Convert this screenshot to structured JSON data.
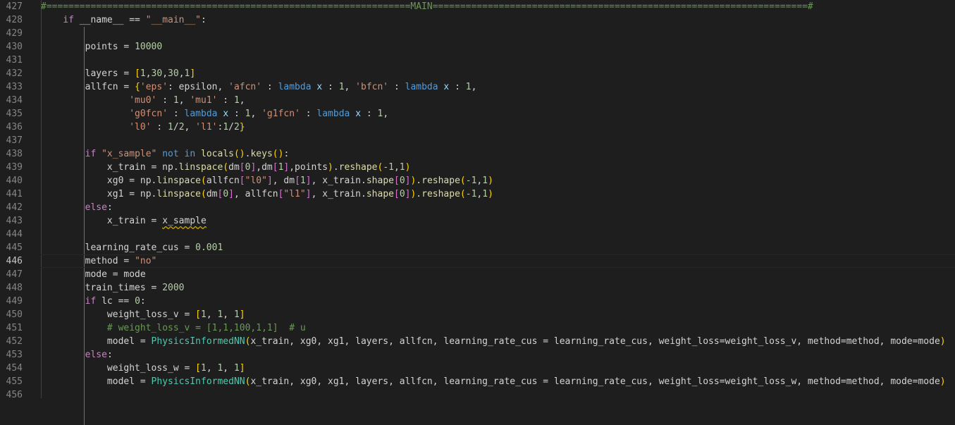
{
  "colors": {
    "background": "#1e1e1e",
    "line_number": "#858585",
    "line_number_active": "#c6c6c6",
    "default": "#d4d4d4",
    "keyword_control": "#c586c0",
    "keyword": "#569cd6",
    "string": "#ce9178",
    "number": "#b5cea8",
    "function": "#dcdcaa",
    "class": "#4ec9b0",
    "variable": "#9cdcfe",
    "comment": "#6a9955",
    "bracket1": "#ffd700",
    "bracket2": "#da70d6",
    "bracket3": "#179fff"
  },
  "editor": {
    "current_line": "446",
    "lines": [
      {
        "n": "427",
        "tokens": [
          [
            "#==================================================================MAIN====================================================================#",
            "comment"
          ]
        ]
      },
      {
        "n": "428",
        "tokens": [
          [
            "    ",
            ""
          ],
          [
            "if",
            "keyword_control"
          ],
          [
            " __name__ == ",
            ""
          ],
          [
            "\"__main__\"",
            "string"
          ],
          [
            ":",
            ""
          ]
        ]
      },
      {
        "n": "429",
        "tokens": []
      },
      {
        "n": "430",
        "tokens": [
          [
            "        points = ",
            ""
          ],
          [
            "10000",
            "number"
          ]
        ]
      },
      {
        "n": "431",
        "tokens": []
      },
      {
        "n": "432",
        "tokens": [
          [
            "        layers = ",
            ""
          ],
          [
            "[",
            "bracket1"
          ],
          [
            "1",
            "number"
          ],
          [
            ",",
            ""
          ],
          [
            "30",
            "number"
          ],
          [
            ",",
            ""
          ],
          [
            "30",
            "number"
          ],
          [
            ",",
            ""
          ],
          [
            "1",
            "number"
          ],
          [
            "]",
            "bracket1"
          ]
        ]
      },
      {
        "n": "433",
        "tokens": [
          [
            "        allfcn = ",
            ""
          ],
          [
            "{",
            "bracket1"
          ],
          [
            "'eps'",
            "string"
          ],
          [
            ": epsilon, ",
            ""
          ],
          [
            "'afcn'",
            "string"
          ],
          [
            " : ",
            ""
          ],
          [
            "lambda",
            "keyword"
          ],
          [
            " ",
            ""
          ],
          [
            "x",
            "variable"
          ],
          [
            " : ",
            ""
          ],
          [
            "1",
            "number"
          ],
          [
            ", ",
            ""
          ],
          [
            "'bfcn'",
            "string"
          ],
          [
            " : ",
            ""
          ],
          [
            "lambda",
            "keyword"
          ],
          [
            " ",
            ""
          ],
          [
            "x",
            "variable"
          ],
          [
            " : ",
            ""
          ],
          [
            "1",
            "number"
          ],
          [
            ",",
            ""
          ]
        ]
      },
      {
        "n": "434",
        "tokens": [
          [
            "                ",
            ""
          ],
          [
            "'mu0'",
            "string"
          ],
          [
            " : ",
            ""
          ],
          [
            "1",
            "number"
          ],
          [
            ", ",
            ""
          ],
          [
            "'mu1'",
            "string"
          ],
          [
            " : ",
            ""
          ],
          [
            "1",
            "number"
          ],
          [
            ",",
            ""
          ]
        ]
      },
      {
        "n": "435",
        "tokens": [
          [
            "                ",
            ""
          ],
          [
            "'g0fcn'",
            "string"
          ],
          [
            " : ",
            ""
          ],
          [
            "lambda",
            "keyword"
          ],
          [
            " ",
            ""
          ],
          [
            "x",
            "variable"
          ],
          [
            " : ",
            ""
          ],
          [
            "1",
            "number"
          ],
          [
            ", ",
            ""
          ],
          [
            "'g1fcn'",
            "string"
          ],
          [
            " : ",
            ""
          ],
          [
            "lambda",
            "keyword"
          ],
          [
            " ",
            ""
          ],
          [
            "x",
            "variable"
          ],
          [
            " : ",
            ""
          ],
          [
            "1",
            "number"
          ],
          [
            ",",
            ""
          ]
        ]
      },
      {
        "n": "436",
        "tokens": [
          [
            "                ",
            ""
          ],
          [
            "'l0'",
            "string"
          ],
          [
            " : ",
            ""
          ],
          [
            "1",
            "number"
          ],
          [
            "/",
            ""
          ],
          [
            "2",
            "number"
          ],
          [
            ", ",
            ""
          ],
          [
            "'l1'",
            "string"
          ],
          [
            ":",
            ""
          ],
          [
            "1",
            "number"
          ],
          [
            "/",
            ""
          ],
          [
            "2",
            "number"
          ],
          [
            "}",
            "bracket1"
          ]
        ]
      },
      {
        "n": "437",
        "tokens": []
      },
      {
        "n": "438",
        "tokens": [
          [
            "        ",
            ""
          ],
          [
            "if",
            "keyword_control"
          ],
          [
            " ",
            ""
          ],
          [
            "\"x_sample\"",
            "string"
          ],
          [
            " ",
            ""
          ],
          [
            "not",
            "keyword"
          ],
          [
            " ",
            ""
          ],
          [
            "in",
            "keyword"
          ],
          [
            " ",
            ""
          ],
          [
            "locals",
            "function"
          ],
          [
            "()",
            "bracket1"
          ],
          [
            ".",
            ""
          ],
          [
            "keys",
            "function"
          ],
          [
            "()",
            "bracket1"
          ],
          [
            ":",
            ""
          ]
        ]
      },
      {
        "n": "439",
        "tokens": [
          [
            "            x_train = np.",
            ""
          ],
          [
            "linspace",
            "function"
          ],
          [
            "(",
            "bracket1"
          ],
          [
            "dm",
            ""
          ],
          [
            "[",
            "bracket2"
          ],
          [
            "0",
            "number"
          ],
          [
            "]",
            "bracket2"
          ],
          [
            ",dm",
            ""
          ],
          [
            "[",
            "bracket2"
          ],
          [
            "1",
            "number"
          ],
          [
            "]",
            "bracket2"
          ],
          [
            ",points",
            ""
          ],
          [
            ")",
            "bracket1"
          ],
          [
            ".",
            ""
          ],
          [
            "reshape",
            "function"
          ],
          [
            "(",
            "bracket1"
          ],
          [
            "-1",
            "number"
          ],
          [
            ",",
            ""
          ],
          [
            "1",
            "number"
          ],
          [
            ")",
            "bracket1"
          ]
        ]
      },
      {
        "n": "440",
        "tokens": [
          [
            "            xg0 = np.",
            ""
          ],
          [
            "linspace",
            "function"
          ],
          [
            "(",
            "bracket1"
          ],
          [
            "allfcn",
            ""
          ],
          [
            "[",
            "bracket2"
          ],
          [
            "\"l0\"",
            "string"
          ],
          [
            "]",
            "bracket2"
          ],
          [
            ", dm",
            ""
          ],
          [
            "[",
            "bracket2"
          ],
          [
            "1",
            "number"
          ],
          [
            "]",
            "bracket2"
          ],
          [
            ", x_train.",
            ""
          ],
          [
            "shape",
            "function"
          ],
          [
            "[",
            "bracket2"
          ],
          [
            "0",
            "number"
          ],
          [
            "]",
            "bracket2"
          ],
          [
            ")",
            "bracket1"
          ],
          [
            ".",
            ""
          ],
          [
            "reshape",
            "function"
          ],
          [
            "(",
            "bracket1"
          ],
          [
            "-1",
            "number"
          ],
          [
            ",",
            ""
          ],
          [
            "1",
            "number"
          ],
          [
            ")",
            "bracket1"
          ]
        ]
      },
      {
        "n": "441",
        "tokens": [
          [
            "            xg1 = np.",
            ""
          ],
          [
            "linspace",
            "function"
          ],
          [
            "(",
            "bracket1"
          ],
          [
            "dm",
            ""
          ],
          [
            "[",
            "bracket2"
          ],
          [
            "0",
            "number"
          ],
          [
            "]",
            "bracket2"
          ],
          [
            ", allfcn",
            ""
          ],
          [
            "[",
            "bracket2"
          ],
          [
            "\"l1\"",
            "string"
          ],
          [
            "]",
            "bracket2"
          ],
          [
            ", x_train.",
            ""
          ],
          [
            "shape",
            "function"
          ],
          [
            "[",
            "bracket2"
          ],
          [
            "0",
            "number"
          ],
          [
            "]",
            "bracket2"
          ],
          [
            ")",
            "bracket1"
          ],
          [
            ".",
            ""
          ],
          [
            "reshape",
            "function"
          ],
          [
            "(",
            "bracket1"
          ],
          [
            "-1",
            "number"
          ],
          [
            ",",
            ""
          ],
          [
            "1",
            "number"
          ],
          [
            ")",
            "bracket1"
          ]
        ]
      },
      {
        "n": "442",
        "tokens": [
          [
            "        ",
            ""
          ],
          [
            "else",
            "keyword_control"
          ],
          [
            ":",
            ""
          ]
        ]
      },
      {
        "n": "443",
        "tokens": [
          [
            "            x_train = ",
            ""
          ],
          [
            "x_sample",
            "squiggle"
          ]
        ]
      },
      {
        "n": "444",
        "tokens": []
      },
      {
        "n": "445",
        "tokens": [
          [
            "        learning_rate_cus = ",
            ""
          ],
          [
            "0.001",
            "number"
          ]
        ]
      },
      {
        "n": "446",
        "tokens": [
          [
            "        method = ",
            ""
          ],
          [
            "\"no\"",
            "string"
          ]
        ]
      },
      {
        "n": "447",
        "tokens": [
          [
            "        mode = mode",
            ""
          ]
        ]
      },
      {
        "n": "448",
        "tokens": [
          [
            "        train_times = ",
            ""
          ],
          [
            "2000",
            "number"
          ]
        ]
      },
      {
        "n": "449",
        "tokens": [
          [
            "        ",
            ""
          ],
          [
            "if",
            "keyword_control"
          ],
          [
            " lc == ",
            ""
          ],
          [
            "0",
            "number"
          ],
          [
            ":",
            ""
          ]
        ]
      },
      {
        "n": "450",
        "tokens": [
          [
            "            weight_loss_v = ",
            ""
          ],
          [
            "[",
            "bracket1"
          ],
          [
            "1",
            "number"
          ],
          [
            ", ",
            ""
          ],
          [
            "1",
            "number"
          ],
          [
            ", ",
            ""
          ],
          [
            "1",
            "number"
          ],
          [
            "]",
            "bracket1"
          ]
        ]
      },
      {
        "n": "451",
        "tokens": [
          [
            "            ",
            ""
          ],
          [
            "# weight_loss_v = [1,1,100,1,1]  # u",
            "comment"
          ]
        ]
      },
      {
        "n": "452",
        "tokens": [
          [
            "            model = ",
            ""
          ],
          [
            "PhysicsInformedNN",
            "class"
          ],
          [
            "(",
            "bracket1"
          ],
          [
            "x_train, xg0, xg1, layers, allfcn, learning_rate_cus = learning_rate_cus, weight_loss=weight_loss_v, method=method, mode=mode",
            ""
          ],
          [
            ")",
            "bracket1"
          ]
        ]
      },
      {
        "n": "453",
        "tokens": [
          [
            "        ",
            ""
          ],
          [
            "else",
            "keyword_control"
          ],
          [
            ":",
            ""
          ]
        ]
      },
      {
        "n": "454",
        "tokens": [
          [
            "            weight_loss_w = ",
            ""
          ],
          [
            "[",
            "bracket1"
          ],
          [
            "1",
            "number"
          ],
          [
            ", ",
            ""
          ],
          [
            "1",
            "number"
          ],
          [
            ", ",
            ""
          ],
          [
            "1",
            "number"
          ],
          [
            "]",
            "bracket1"
          ]
        ]
      },
      {
        "n": "455",
        "tokens": [
          [
            "            model = ",
            ""
          ],
          [
            "PhysicsInformedNN",
            "class"
          ],
          [
            "(",
            "bracket1"
          ],
          [
            "x_train, xg0, xg1, layers, allfcn, learning_rate_cus = learning_rate_cus, weight_loss=weight_loss_w, method=method, mode=mode",
            ""
          ],
          [
            ")",
            "bracket1"
          ]
        ]
      },
      {
        "n": "456",
        "tokens": []
      }
    ]
  }
}
